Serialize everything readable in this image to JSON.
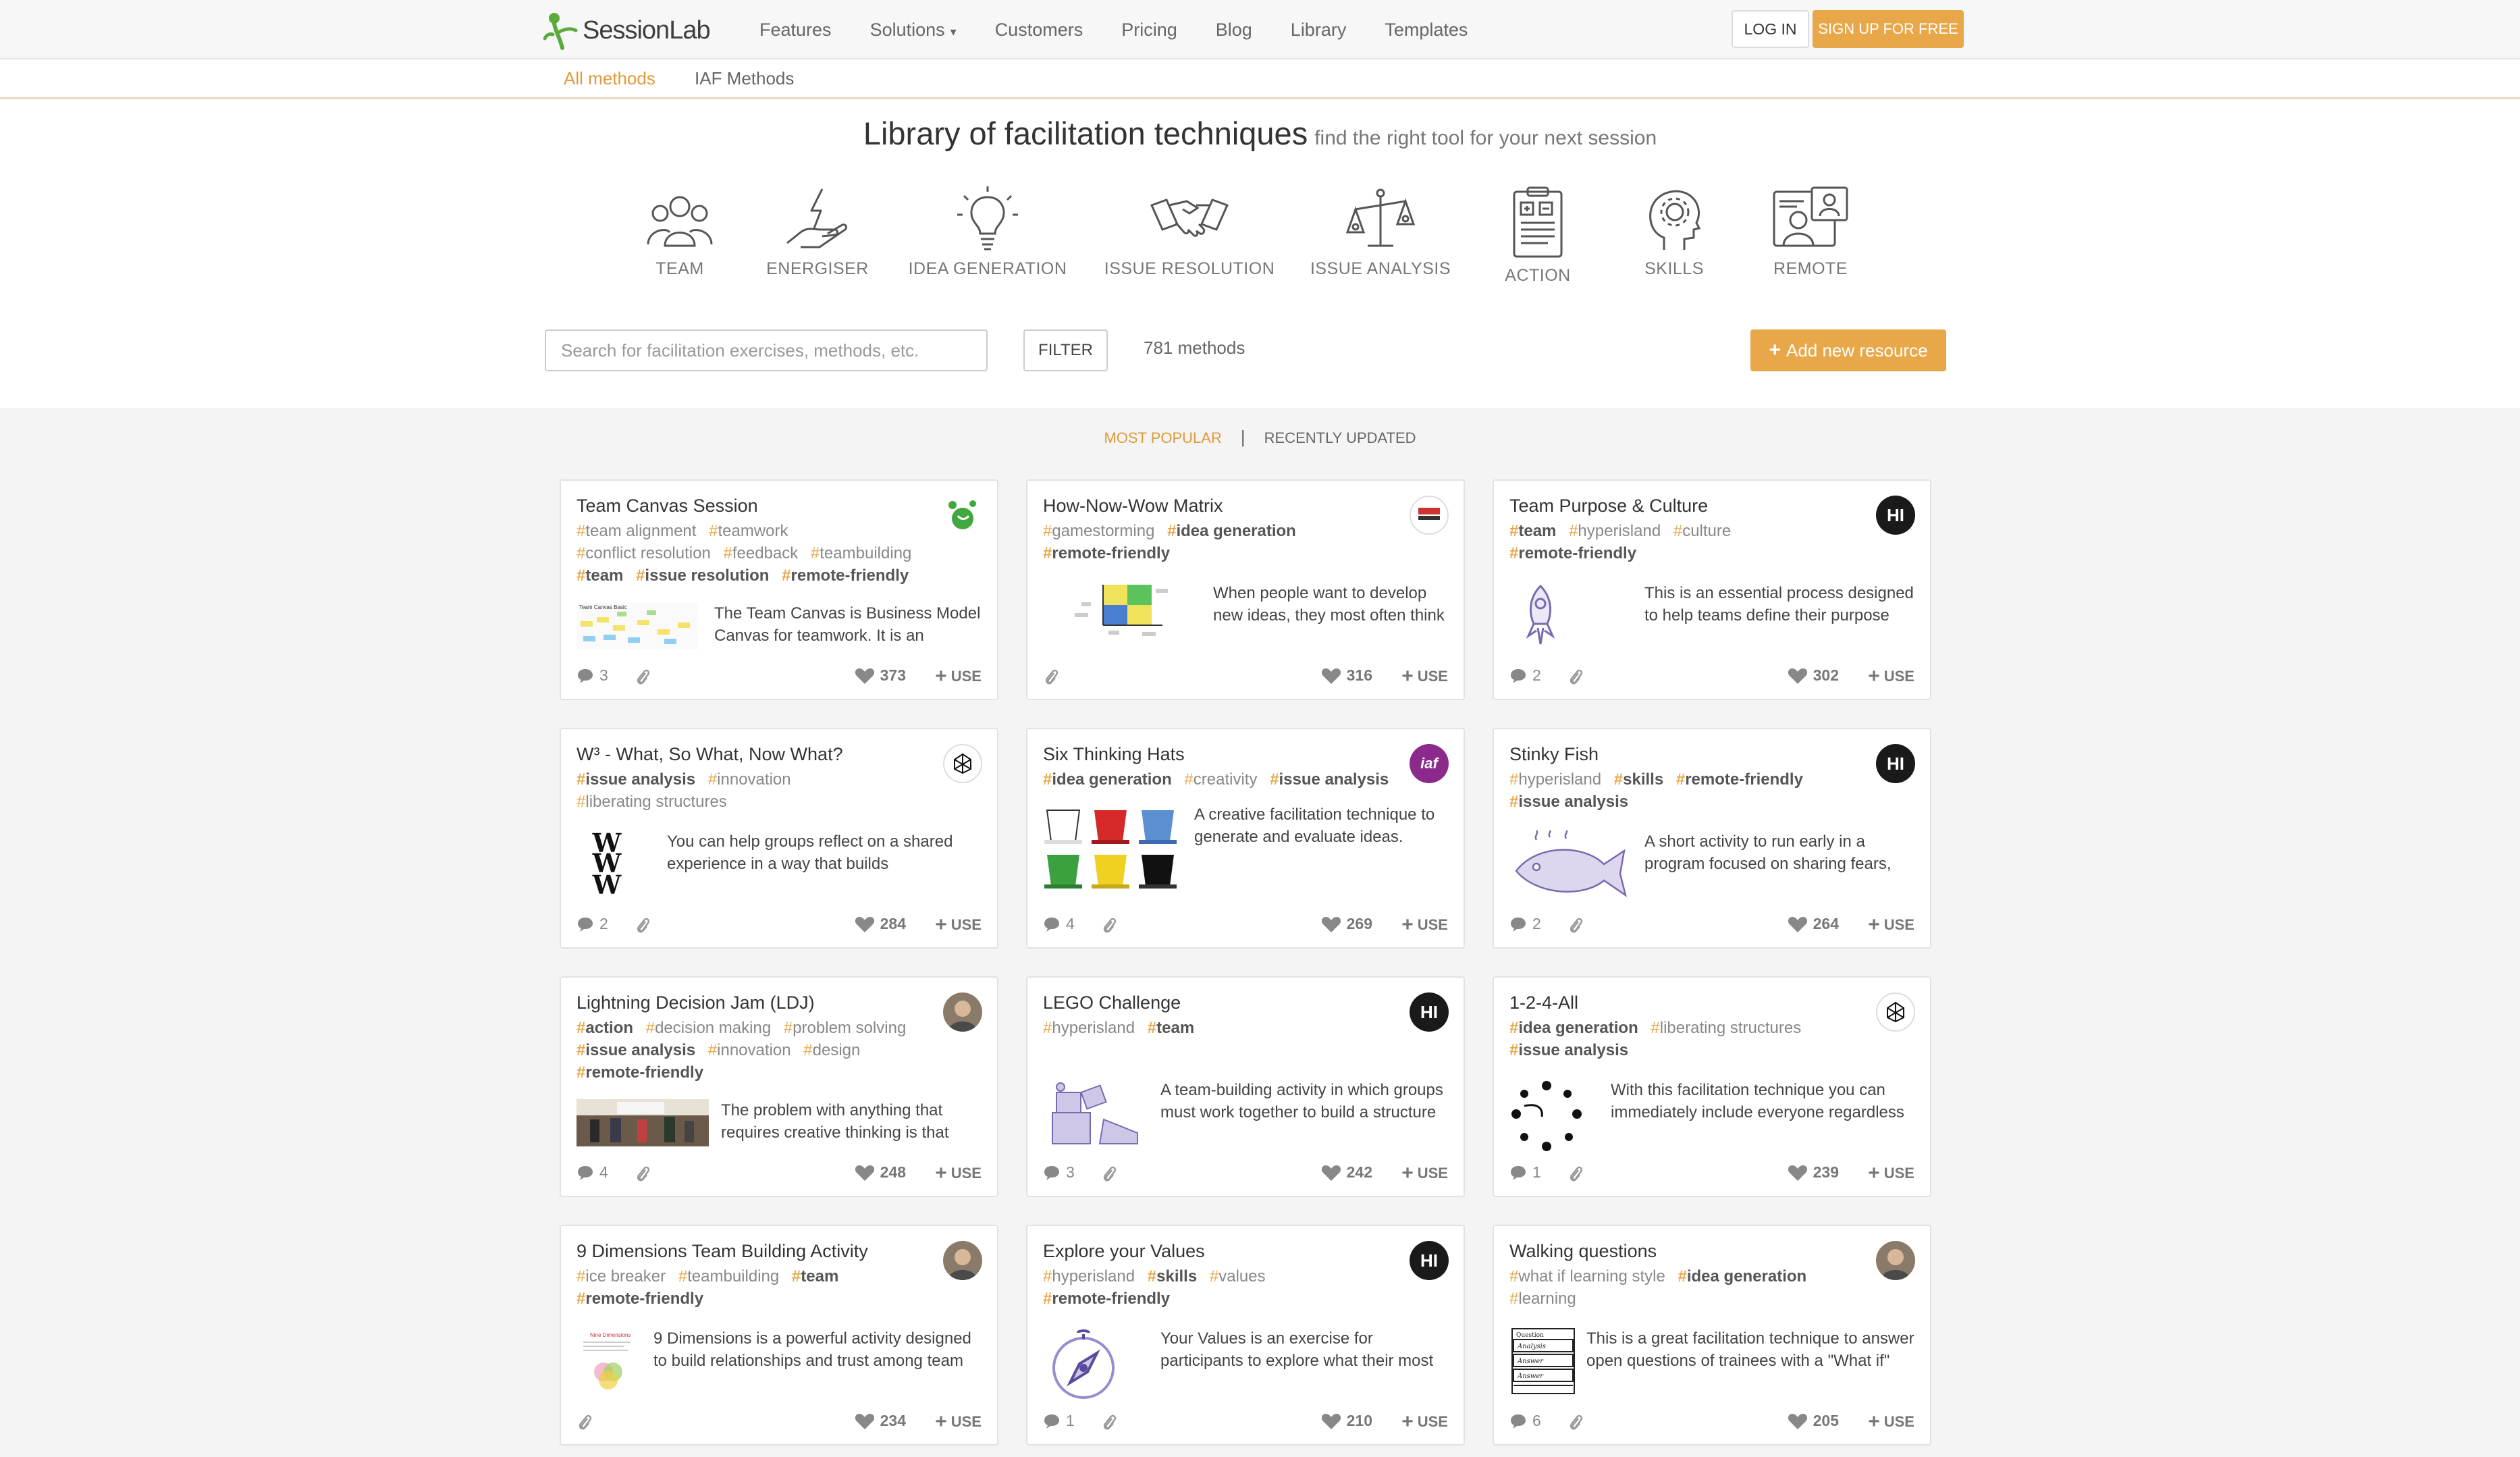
{
  "brand": {
    "name": "SessionLab",
    "accent": "#e8a84a",
    "logo_green": "#5aab3c"
  },
  "nav": {
    "links": [
      "Features",
      "Solutions",
      "Customers",
      "Pricing",
      "Blog",
      "Library",
      "Templates"
    ],
    "login": "LOG IN",
    "signup": "SIGN UP FOR FREE"
  },
  "subnav": {
    "items": [
      "All methods",
      "IAF Methods"
    ]
  },
  "header": {
    "title": "Library of facilitation techniques",
    "subtitle": "find the right tool for your next session",
    "categories": [
      {
        "label": "TEAM",
        "icon": "team-icon"
      },
      {
        "label": "ENERGISER",
        "icon": "energiser-icon"
      },
      {
        "label": "IDEA GENERATION",
        "icon": "lightbulb-icon"
      },
      {
        "label": "ISSUE RESOLUTION",
        "icon": "handshake-icon"
      },
      {
        "label": "ISSUE ANALYSIS",
        "icon": "scales-icon"
      },
      {
        "label": "ACTION",
        "icon": "clipboard-icon"
      },
      {
        "label": "SKILLS",
        "icon": "head-gear-icon"
      },
      {
        "label": "REMOTE",
        "icon": "remote-icon"
      }
    ]
  },
  "search": {
    "placeholder": "Search for facilitation exercises, methods, etc.",
    "filter": "FILTER",
    "count": "781 methods"
  },
  "add_resource": "Add new resource",
  "sort": {
    "active": "MOST POPULAR",
    "separator": "|",
    "other": "RECENTLY UPDATED"
  },
  "cards": [
    {
      "title": "Team Canvas Session",
      "tags": [
        [
          "team alignment",
          false
        ],
        [
          "teamwork",
          false
        ],
        [
          "conflict resolution",
          false
        ],
        [
          "feedback",
          false
        ],
        [
          "teambuilding",
          false
        ],
        [
          "team",
          true
        ],
        [
          "issue resolution",
          true
        ],
        [
          "remote-friendly",
          true
        ]
      ],
      "desc": "The Team Canvas is Business Model Canvas for teamwork. It is an",
      "comments": "3",
      "likes": "373",
      "use": "USE",
      "badge": "green-logo"
    },
    {
      "title": "How-Now-Wow Matrix",
      "tags": [
        [
          "gamestorming",
          false
        ],
        [
          "idea generation",
          true
        ],
        [
          "remote-friendly",
          true
        ]
      ],
      "desc": "When people want to develop new ideas, they most often think out of the box in the",
      "comments": "",
      "likes": "316",
      "use": "USE",
      "badge": "gamestorming-logo"
    },
    {
      "title": "Team Purpose & Culture",
      "tags": [
        [
          "team",
          true
        ],
        [
          "hyperisland",
          false
        ],
        [
          "culture",
          false
        ],
        [
          "remote-friendly",
          true
        ]
      ],
      "desc": "This is an essential process designed to help teams define their purpose (why they exist) and their culture (how they",
      "comments": "2",
      "likes": "302",
      "use": "USE",
      "badge": "HI"
    },
    {
      "title": "W³ - What, So What, Now What?",
      "tags": [
        [
          "issue analysis",
          true
        ],
        [
          "innovation",
          false
        ],
        [
          "liberating structures",
          false
        ]
      ],
      "desc": "You can help groups reflect on a shared experience in a way that builds understanding and spurs coordinated",
      "comments": "2",
      "likes": "284",
      "use": "USE",
      "badge": "ls-logo"
    },
    {
      "title": "Six Thinking Hats",
      "tags": [
        [
          "idea generation",
          true
        ],
        [
          "creativity",
          false
        ],
        [
          "issue analysis",
          true
        ]
      ],
      "desc": "A creative facilitation technique to generate and evaluate ideas.",
      "comments": "4",
      "likes": "269",
      "use": "USE",
      "badge": "iaf-logo"
    },
    {
      "title": "Stinky Fish",
      "tags": [
        [
          "hyperisland",
          false
        ],
        [
          "skills",
          true
        ],
        [
          "remote-friendly",
          true
        ],
        [
          "issue analysis",
          true
        ]
      ],
      "desc": "A short activity to run early in a program focused on sharing fears, anxieties and uncertainties related",
      "comments": "2",
      "likes": "264",
      "use": "USE",
      "badge": "HI"
    },
    {
      "title": "Lightning Decision Jam (LDJ)",
      "tags": [
        [
          "action",
          true
        ],
        [
          "decision making",
          false
        ],
        [
          "problem solving",
          false
        ],
        [
          "issue analysis",
          true
        ],
        [
          "innovation",
          false
        ],
        [
          "design",
          false
        ],
        [
          "remote-friendly",
          true
        ]
      ],
      "desc": "The problem with anything that requires creative thinking is that",
      "comments": "4",
      "likes": "248",
      "use": "USE",
      "badge": "avatar"
    },
    {
      "title": "LEGO Challenge",
      "tags": [
        [
          "hyperisland",
          false
        ],
        [
          "team",
          true
        ]
      ],
      "desc": "A team-building activity in which groups must work together to build a structure out of LEGO, but each individual has a secret “assignment”",
      "comments": "3",
      "likes": "242",
      "use": "USE",
      "badge": "HI"
    },
    {
      "title": "1-2-4-All",
      "tags": [
        [
          "idea generation",
          true
        ],
        [
          "liberating structures",
          false
        ],
        [
          "issue analysis",
          true
        ]
      ],
      "desc": "With this facilitation technique you can immediately include everyone regardless of how large the group is. You can",
      "comments": "1",
      "likes": "239",
      "use": "USE",
      "badge": "ls-logo"
    },
    {
      "title": "9 Dimensions Team Building Activity",
      "tags": [
        [
          "ice breaker",
          false
        ],
        [
          "teambuilding",
          false
        ],
        [
          "team",
          true
        ],
        [
          "remote-friendly",
          true
        ]
      ],
      "desc": "9 Dimensions is a powerful activity designed to build relationships and trust among team members.",
      "comments": "",
      "likes": "234",
      "use": "USE",
      "badge": "avatar"
    },
    {
      "title": "Explore your Values",
      "tags": [
        [
          "hyperisland",
          false
        ],
        [
          "skills",
          true
        ],
        [
          "values",
          false
        ],
        [
          "remote-friendly",
          true
        ]
      ],
      "desc": "Your Values is an exercise for participants to explore what their most important values are. It’s done in an",
      "comments": "1",
      "likes": "210",
      "use": "USE",
      "badge": "HI"
    },
    {
      "title": "Walking questions",
      "tags": [
        [
          "what if learning style",
          false
        ],
        [
          "idea generation",
          true
        ],
        [
          "learning",
          false
        ]
      ],
      "desc": "This is a great facilitation technique to answer open questions of trainees with a \"What if\" learning style. It prevents the",
      "comments": "6",
      "likes": "205",
      "use": "USE",
      "badge": "avatar"
    }
  ]
}
